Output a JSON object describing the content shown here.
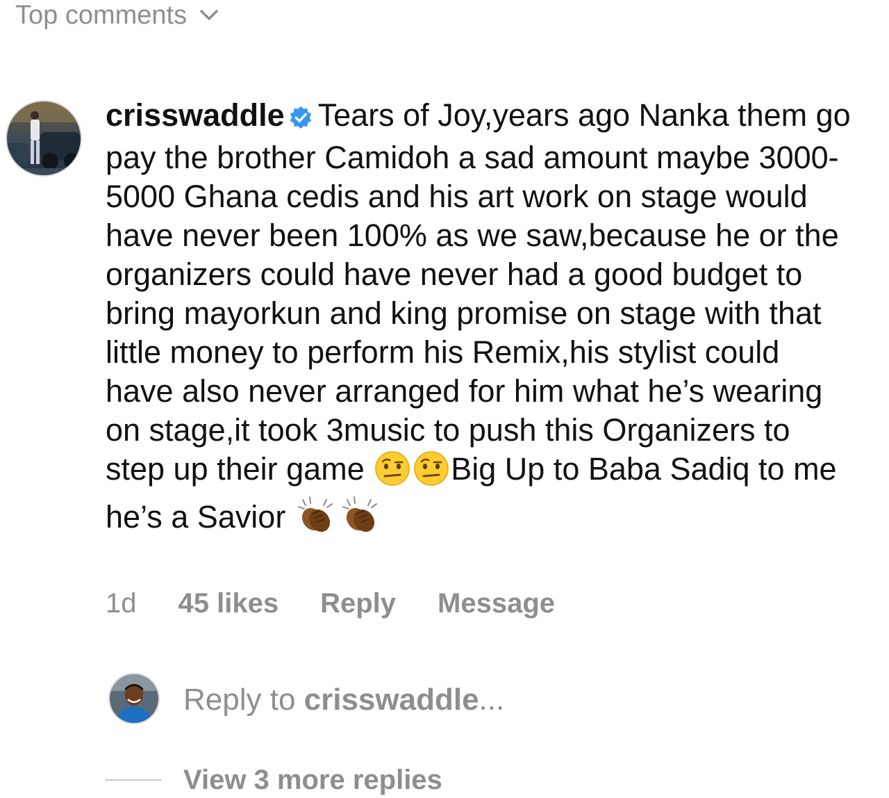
{
  "header": {
    "sort_label": "Top comments"
  },
  "comment": {
    "username": "crisswaddle",
    "verified": true,
    "text_main": "Tears of Joy,years ago Nanka them go pay the brother Camidoh a sad amount maybe 3000-5000 Ghana cedis and his art work on stage would have never been 100% as we saw,because he or the organizers could have never had a good budget to bring mayorkun and king promise on stage with that little money to perform his Remix,his stylist could have also never arranged for him what he’s wearing on stage,it took 3music to push this Organizers to step up their game",
    "text_mid": "Big Up to Baba Sadiq to me he’s a Savior",
    "emoji_1": "raised-eyebrow-emoji",
    "emoji_2": "clapping-hands-emoji",
    "time": "1d",
    "likes": "45 likes",
    "reply_label": "Reply",
    "message_label": "Message"
  },
  "reply_box": {
    "prefix": "Reply to ",
    "mention": "crisswaddle",
    "suffix": "..."
  },
  "replies": {
    "view_more_label": "View 3 more replies"
  },
  "colors": {
    "text_primary": "#111111",
    "text_secondary": "#8e8e8e",
    "verified_badge": "#3897f0"
  }
}
